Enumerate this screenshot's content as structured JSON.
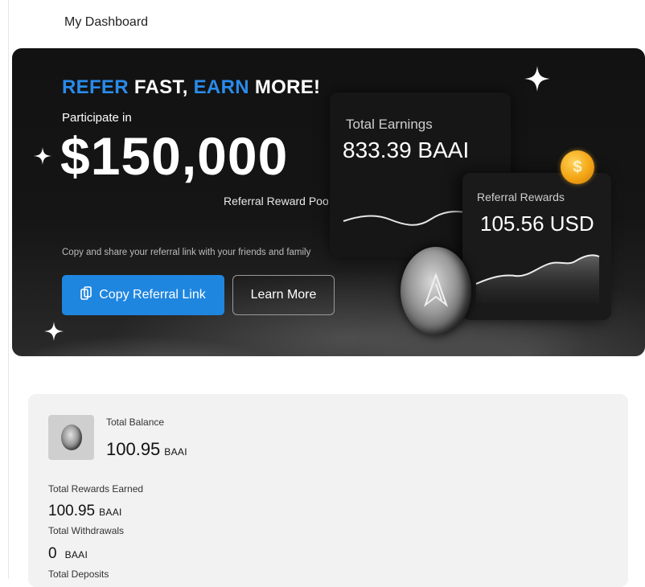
{
  "page": {
    "title": "My Dashboard"
  },
  "banner": {
    "headline": {
      "part1": "REFER",
      "part2": "FAST,",
      "part3": "EARN",
      "part4": "MORE!"
    },
    "participate": "Participate in",
    "amount": "$150,000",
    "pool_label": "Referral Reward Pool",
    "share_text": "Copy and share your referral link with your friends and family",
    "copy_button": "Copy Referral Link",
    "learn_button": "Learn More",
    "earnings_card": {
      "label": "Total Earnings",
      "value": "833.39 BAAI"
    },
    "referral_card": {
      "label": "Referral Rewards",
      "value": "105.56 USD"
    },
    "colors": {
      "accent": "#2a8bea",
      "button": "#1f86e0",
      "coin_gold": "#f3a514"
    },
    "icons": [
      "copy-icon",
      "sparkle-icon",
      "dollar-coin-icon",
      "brand-coin-icon"
    ]
  },
  "balance": {
    "total_balance": {
      "label": "Total Balance",
      "value": "100.95",
      "unit": "BAAI"
    },
    "rewards": {
      "label": "Total Rewards Earned",
      "value": "100.95",
      "unit": "BAAI"
    },
    "withdrawals": {
      "label": "Total Withdrawals",
      "value": "0",
      "unit": "BAAI"
    },
    "deposits": {
      "label": "Total Deposits"
    }
  }
}
